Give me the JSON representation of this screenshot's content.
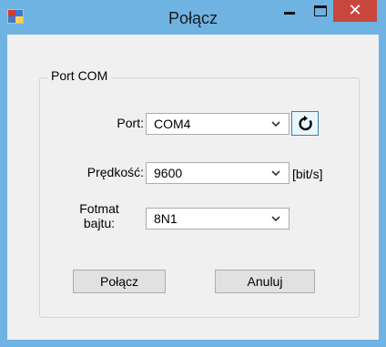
{
  "window": {
    "title": "Połącz",
    "close_symbol": "✕",
    "icons": {
      "app": "app-icon",
      "minimize": "minimize-icon",
      "maximize": "maximize-icon",
      "close": "close-icon"
    },
    "colors": {
      "titlebar": "#6fb3e3",
      "close": "#c9463d",
      "client": "#f0f0f0"
    }
  },
  "group": {
    "title": "Port COM",
    "port": {
      "label": "Port:",
      "value": "COM4",
      "refresh_icon": "refresh-icon"
    },
    "speed": {
      "label": "Prędkość:",
      "value": "9600",
      "unit": "[bit/s]"
    },
    "format": {
      "label_line1": "Fotmat",
      "label_line2": "bajtu:",
      "value": "8N1"
    }
  },
  "buttons": {
    "connect": "Połącz",
    "cancel": "Anuluj"
  }
}
